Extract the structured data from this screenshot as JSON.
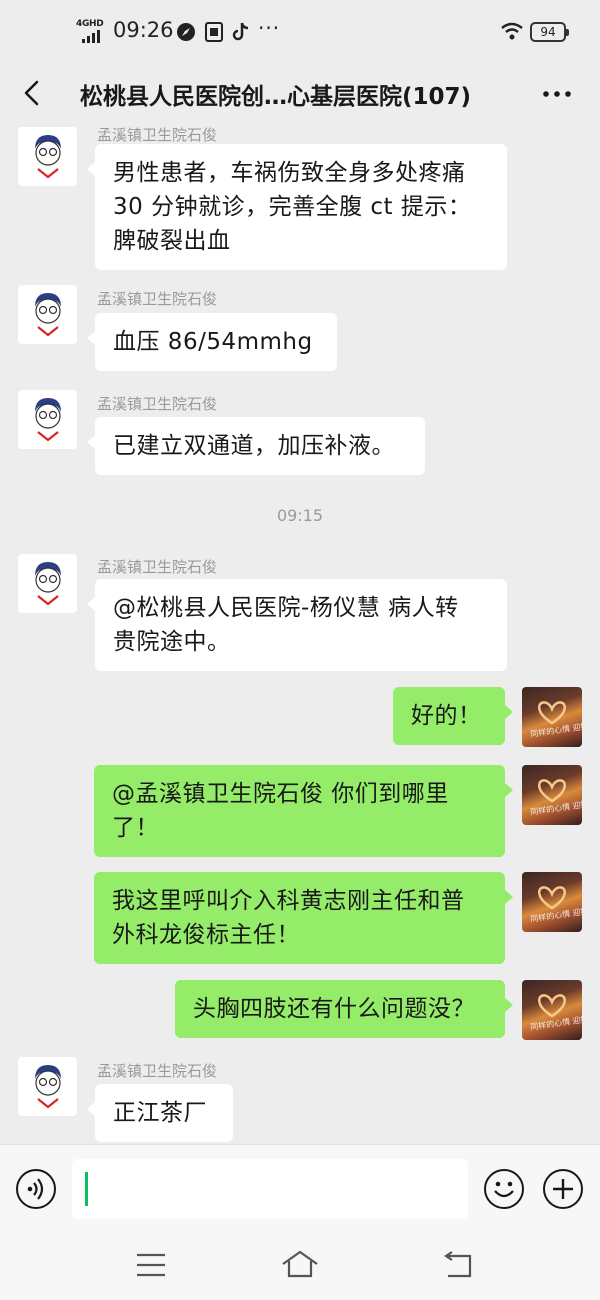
{
  "status_bar": {
    "network": "4GHD",
    "time": "09:26",
    "more": "···",
    "battery": "94"
  },
  "nav": {
    "title": "松桃县人民医院创…心基层医院(107)"
  },
  "messages": [
    {
      "sender": "孟溪镇卫生院石俊",
      "lines": [
        "男性患者，车祸伤致全身多处疼痛",
        "30 分钟就诊，完善全腹 ct 提示：",
        "脾破裂出血"
      ]
    },
    {
      "sender": "孟溪镇卫生院石俊",
      "lines": [
        "血压 86/54mmhg"
      ]
    },
    {
      "sender": "孟溪镇卫生院石俊",
      "lines": [
        "已建立双通道，加压补液。"
      ]
    },
    {
      "sender": "孟溪镇卫生院石俊",
      "lines": [
        "@松桃县人民医院-杨仪慧  病人转",
        "贵院途中。"
      ]
    },
    {
      "lines": [
        "好的！"
      ]
    },
    {
      "lines": [
        "@孟溪镇卫生院石俊  你们到哪里",
        "了！"
      ]
    },
    {
      "lines": [
        "我这里呼叫介入科黄志刚主任和普",
        "外科龙俊标主任！"
      ]
    },
    {
      "lines": [
        "头胸四肢还有什么问题没？"
      ]
    },
    {
      "sender": "孟溪镇卫生院石俊",
      "lines": [
        "正江茶厂"
      ]
    }
  ],
  "timestamp": "09:15",
  "avatar_caption": "同样的心情 迎接到的一",
  "colors": {
    "accent_green": "#95ec69",
    "background": "#ededed",
    "cursor": "#07c160"
  },
  "icons": {
    "back": "chevron-left-icon",
    "more": "more-icon",
    "voice": "voice-icon",
    "emoji": "emoji-icon",
    "add": "plus-icon"
  }
}
